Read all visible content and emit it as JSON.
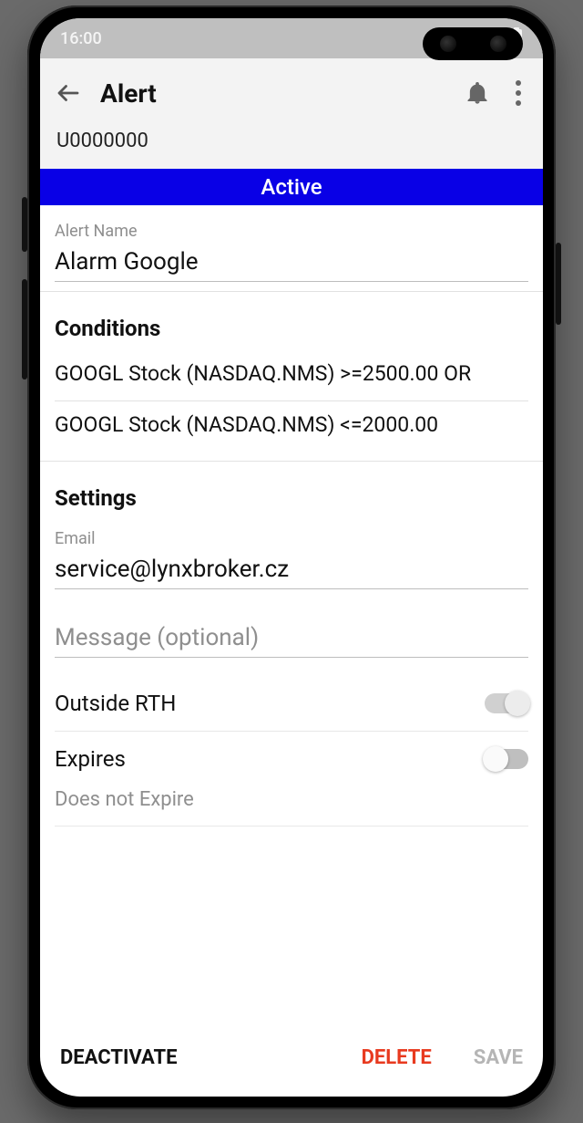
{
  "statusbar": {
    "time": "16:00"
  },
  "appbar": {
    "title": "Alert"
  },
  "account": "U0000000",
  "status": "Active",
  "alertName": {
    "label": "Alert Name",
    "value": "Alarm Google"
  },
  "conditions": {
    "title": "Conditions",
    "items": [
      "GOOGL Stock (NASDAQ.NMS) >=2500.00 OR",
      "GOOGL Stock (NASDAQ.NMS) <=2000.00"
    ]
  },
  "settings": {
    "title": "Settings",
    "emailLabel": "Email",
    "emailValue": "service@lynxbroker.cz",
    "messagePlaceholder": "Message (optional)",
    "outsideRTH": {
      "label": "Outside RTH",
      "on": false
    },
    "expires": {
      "label": "Expires",
      "on": false
    },
    "expiryText": "Does not Expire"
  },
  "actions": {
    "deactivate": "DEACTIVATE",
    "delete": "DELETE",
    "save": "SAVE"
  }
}
